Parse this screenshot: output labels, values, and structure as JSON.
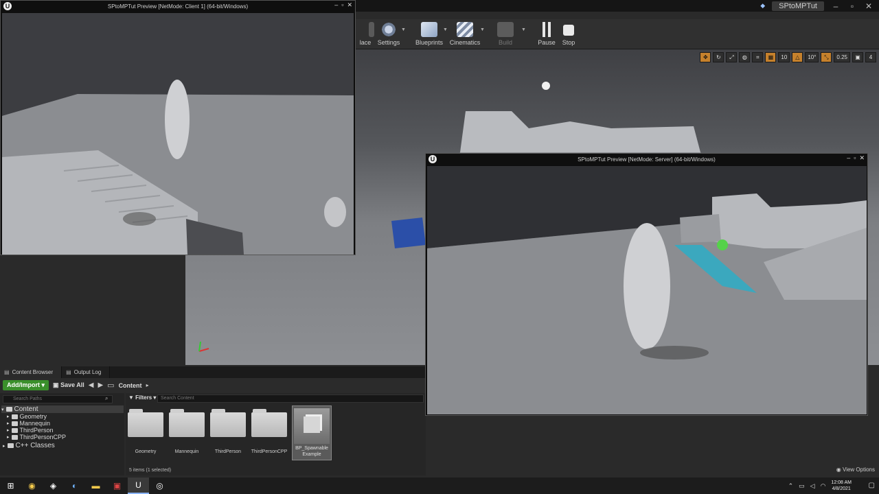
{
  "editor": {
    "project_tab": "SPtoMPTut",
    "toolbar": [
      {
        "label": "lace",
        "icon": "place-icon"
      },
      {
        "label": "Settings",
        "icon": "gear-icon"
      },
      {
        "label": "Blueprints",
        "icon": "blueprint-icon"
      },
      {
        "label": "Cinematics",
        "icon": "clapper-icon"
      },
      {
        "label": "Build",
        "icon": "build-icon"
      },
      {
        "label": "Pause",
        "icon": "pause-icon"
      },
      {
        "label": "Stop",
        "icon": "stop-icon"
      }
    ],
    "viewport_options": [
      "10",
      "10°",
      "0.25",
      "4"
    ]
  },
  "client_window": {
    "title": "SPtoMPTut Preview [NetMode: Client 1]  (64-bit/Windows)"
  },
  "server_window": {
    "title": "SPtoMPTut Preview [NetMode: Server]  (64-bit/Windows)"
  },
  "content_browser": {
    "tabs": [
      "Content Browser",
      "Output Log"
    ],
    "add_import": "Add/Import",
    "save_all": "Save All",
    "breadcrumb": "Content",
    "search_paths_placeholder": "Search Paths",
    "filters": "Filters",
    "search_content_placeholder": "Search Content",
    "tree": {
      "root": "Content",
      "children": [
        "Geometry",
        "Mannequin",
        "ThirdPerson",
        "ThirdPersonCPP"
      ],
      "cpp": "C++ Classes"
    },
    "assets": [
      "Geometry",
      "Mannequin",
      "ThirdPerson",
      "ThirdPersonCPP"
    ],
    "selected_asset_line1": "BP_Spawnable",
    "selected_asset_line2": "Example",
    "item_count": "5 items (1 selected)",
    "view_options": "View Options"
  },
  "taskbar": {
    "time": "12:08 AM",
    "date": "4/8/2021"
  }
}
